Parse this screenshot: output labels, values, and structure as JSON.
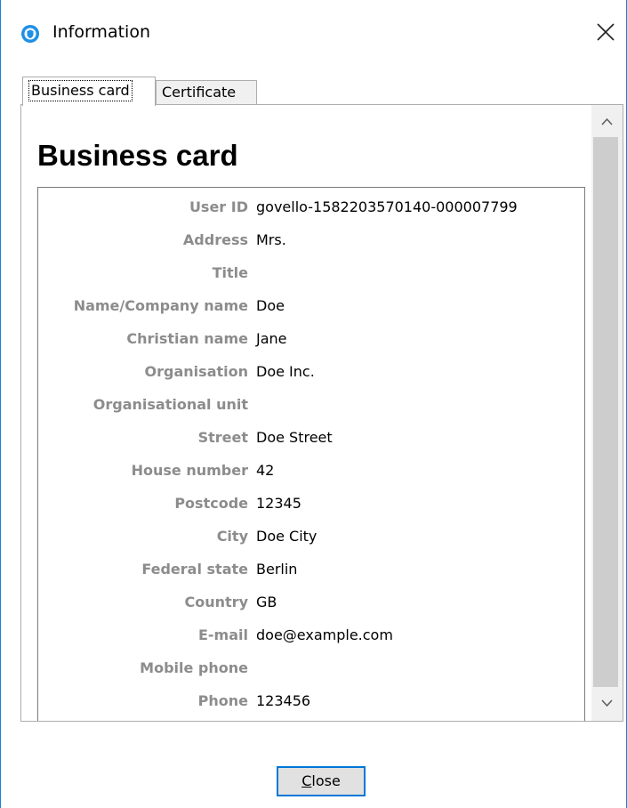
{
  "window": {
    "title": "Information",
    "icon": "app-shield-icon",
    "accent_color": "#1883d7"
  },
  "tabs": [
    {
      "label": "Business card",
      "active": true
    },
    {
      "label": "Certificate",
      "active": false
    }
  ],
  "card": {
    "heading": "Business card",
    "fields": [
      {
        "label": "User ID",
        "value": "govello-1582203570140-000007799"
      },
      {
        "label": "Address",
        "value": "Mrs."
      },
      {
        "label": "Title",
        "value": ""
      },
      {
        "label": "Name/Company name",
        "value": "Doe"
      },
      {
        "label": "Christian name",
        "value": "Jane"
      },
      {
        "label": "Organisation",
        "value": "Doe Inc."
      },
      {
        "label": "Organisational unit",
        "value": ""
      },
      {
        "label": "Street",
        "value": "Doe Street"
      },
      {
        "label": "House number",
        "value": "42"
      },
      {
        "label": "Postcode",
        "value": "12345"
      },
      {
        "label": "City",
        "value": "Doe City"
      },
      {
        "label": "Federal state",
        "value": "Berlin"
      },
      {
        "label": "Country",
        "value": "GB"
      },
      {
        "label": "E-mail",
        "value": "doe@example.com"
      },
      {
        "label": "Mobile phone",
        "value": ""
      },
      {
        "label": "Phone",
        "value": "123456"
      }
    ]
  },
  "buttons": {
    "close_mnemonic": "C",
    "close_rest": "lose"
  }
}
